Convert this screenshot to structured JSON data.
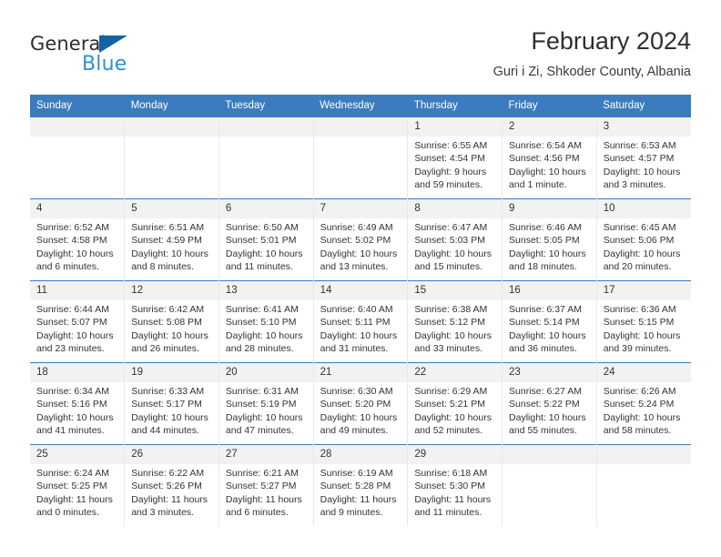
{
  "brand": {
    "name_part1": "General",
    "name_part2": "Blue",
    "triangle_color": "#1463a5",
    "blue_color": "#2e8fd6"
  },
  "header": {
    "title": "February 2024",
    "subtitle": "Guri i Zi, Shkoder County, Albania"
  },
  "theme": {
    "header_blue": "#3a7cbe",
    "daynum_bg": "#f2f2f2",
    "text": "#333333"
  },
  "weekday_headers": [
    "Sunday",
    "Monday",
    "Tuesday",
    "Wednesday",
    "Thursday",
    "Friday",
    "Saturday"
  ],
  "weeks": [
    [
      {
        "day": "",
        "sunrise": "",
        "sunset": "",
        "daylight1": "",
        "daylight2": ""
      },
      {
        "day": "",
        "sunrise": "",
        "sunset": "",
        "daylight1": "",
        "daylight2": ""
      },
      {
        "day": "",
        "sunrise": "",
        "sunset": "",
        "daylight1": "",
        "daylight2": ""
      },
      {
        "day": "",
        "sunrise": "",
        "sunset": "",
        "daylight1": "",
        "daylight2": ""
      },
      {
        "day": "1",
        "sunrise": "Sunrise: 6:55 AM",
        "sunset": "Sunset: 4:54 PM",
        "daylight1": "Daylight: 9 hours",
        "daylight2": "and 59 minutes."
      },
      {
        "day": "2",
        "sunrise": "Sunrise: 6:54 AM",
        "sunset": "Sunset: 4:56 PM",
        "daylight1": "Daylight: 10 hours",
        "daylight2": "and 1 minute."
      },
      {
        "day": "3",
        "sunrise": "Sunrise: 6:53 AM",
        "sunset": "Sunset: 4:57 PM",
        "daylight1": "Daylight: 10 hours",
        "daylight2": "and 3 minutes."
      }
    ],
    [
      {
        "day": "4",
        "sunrise": "Sunrise: 6:52 AM",
        "sunset": "Sunset: 4:58 PM",
        "daylight1": "Daylight: 10 hours",
        "daylight2": "and 6 minutes."
      },
      {
        "day": "5",
        "sunrise": "Sunrise: 6:51 AM",
        "sunset": "Sunset: 4:59 PM",
        "daylight1": "Daylight: 10 hours",
        "daylight2": "and 8 minutes."
      },
      {
        "day": "6",
        "sunrise": "Sunrise: 6:50 AM",
        "sunset": "Sunset: 5:01 PM",
        "daylight1": "Daylight: 10 hours",
        "daylight2": "and 11 minutes."
      },
      {
        "day": "7",
        "sunrise": "Sunrise: 6:49 AM",
        "sunset": "Sunset: 5:02 PM",
        "daylight1": "Daylight: 10 hours",
        "daylight2": "and 13 minutes."
      },
      {
        "day": "8",
        "sunrise": "Sunrise: 6:47 AM",
        "sunset": "Sunset: 5:03 PM",
        "daylight1": "Daylight: 10 hours",
        "daylight2": "and 15 minutes."
      },
      {
        "day": "9",
        "sunrise": "Sunrise: 6:46 AM",
        "sunset": "Sunset: 5:05 PM",
        "daylight1": "Daylight: 10 hours",
        "daylight2": "and 18 minutes."
      },
      {
        "day": "10",
        "sunrise": "Sunrise: 6:45 AM",
        "sunset": "Sunset: 5:06 PM",
        "daylight1": "Daylight: 10 hours",
        "daylight2": "and 20 minutes."
      }
    ],
    [
      {
        "day": "11",
        "sunrise": "Sunrise: 6:44 AM",
        "sunset": "Sunset: 5:07 PM",
        "daylight1": "Daylight: 10 hours",
        "daylight2": "and 23 minutes."
      },
      {
        "day": "12",
        "sunrise": "Sunrise: 6:42 AM",
        "sunset": "Sunset: 5:08 PM",
        "daylight1": "Daylight: 10 hours",
        "daylight2": "and 26 minutes."
      },
      {
        "day": "13",
        "sunrise": "Sunrise: 6:41 AM",
        "sunset": "Sunset: 5:10 PM",
        "daylight1": "Daylight: 10 hours",
        "daylight2": "and 28 minutes."
      },
      {
        "day": "14",
        "sunrise": "Sunrise: 6:40 AM",
        "sunset": "Sunset: 5:11 PM",
        "daylight1": "Daylight: 10 hours",
        "daylight2": "and 31 minutes."
      },
      {
        "day": "15",
        "sunrise": "Sunrise: 6:38 AM",
        "sunset": "Sunset: 5:12 PM",
        "daylight1": "Daylight: 10 hours",
        "daylight2": "and 33 minutes."
      },
      {
        "day": "16",
        "sunrise": "Sunrise: 6:37 AM",
        "sunset": "Sunset: 5:14 PM",
        "daylight1": "Daylight: 10 hours",
        "daylight2": "and 36 minutes."
      },
      {
        "day": "17",
        "sunrise": "Sunrise: 6:36 AM",
        "sunset": "Sunset: 5:15 PM",
        "daylight1": "Daylight: 10 hours",
        "daylight2": "and 39 minutes."
      }
    ],
    [
      {
        "day": "18",
        "sunrise": "Sunrise: 6:34 AM",
        "sunset": "Sunset: 5:16 PM",
        "daylight1": "Daylight: 10 hours",
        "daylight2": "and 41 minutes."
      },
      {
        "day": "19",
        "sunrise": "Sunrise: 6:33 AM",
        "sunset": "Sunset: 5:17 PM",
        "daylight1": "Daylight: 10 hours",
        "daylight2": "and 44 minutes."
      },
      {
        "day": "20",
        "sunrise": "Sunrise: 6:31 AM",
        "sunset": "Sunset: 5:19 PM",
        "daylight1": "Daylight: 10 hours",
        "daylight2": "and 47 minutes."
      },
      {
        "day": "21",
        "sunrise": "Sunrise: 6:30 AM",
        "sunset": "Sunset: 5:20 PM",
        "daylight1": "Daylight: 10 hours",
        "daylight2": "and 49 minutes."
      },
      {
        "day": "22",
        "sunrise": "Sunrise: 6:29 AM",
        "sunset": "Sunset: 5:21 PM",
        "daylight1": "Daylight: 10 hours",
        "daylight2": "and 52 minutes."
      },
      {
        "day": "23",
        "sunrise": "Sunrise: 6:27 AM",
        "sunset": "Sunset: 5:22 PM",
        "daylight1": "Daylight: 10 hours",
        "daylight2": "and 55 minutes."
      },
      {
        "day": "24",
        "sunrise": "Sunrise: 6:26 AM",
        "sunset": "Sunset: 5:24 PM",
        "daylight1": "Daylight: 10 hours",
        "daylight2": "and 58 minutes."
      }
    ],
    [
      {
        "day": "25",
        "sunrise": "Sunrise: 6:24 AM",
        "sunset": "Sunset: 5:25 PM",
        "daylight1": "Daylight: 11 hours",
        "daylight2": "and 0 minutes."
      },
      {
        "day": "26",
        "sunrise": "Sunrise: 6:22 AM",
        "sunset": "Sunset: 5:26 PM",
        "daylight1": "Daylight: 11 hours",
        "daylight2": "and 3 minutes."
      },
      {
        "day": "27",
        "sunrise": "Sunrise: 6:21 AM",
        "sunset": "Sunset: 5:27 PM",
        "daylight1": "Daylight: 11 hours",
        "daylight2": "and 6 minutes."
      },
      {
        "day": "28",
        "sunrise": "Sunrise: 6:19 AM",
        "sunset": "Sunset: 5:28 PM",
        "daylight1": "Daylight: 11 hours",
        "daylight2": "and 9 minutes."
      },
      {
        "day": "29",
        "sunrise": "Sunrise: 6:18 AM",
        "sunset": "Sunset: 5:30 PM",
        "daylight1": "Daylight: 11 hours",
        "daylight2": "and 11 minutes."
      },
      {
        "day": "",
        "sunrise": "",
        "sunset": "",
        "daylight1": "",
        "daylight2": ""
      },
      {
        "day": "",
        "sunrise": "",
        "sunset": "",
        "daylight1": "",
        "daylight2": ""
      }
    ]
  ]
}
